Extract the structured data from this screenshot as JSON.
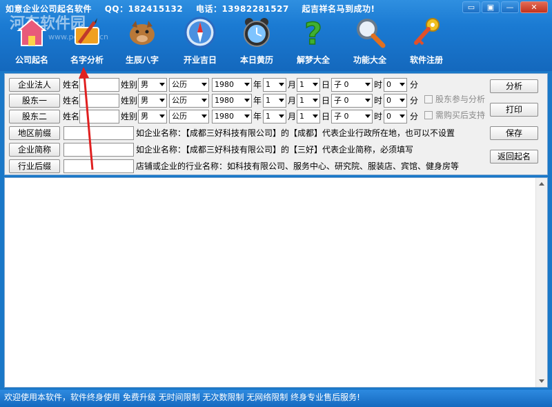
{
  "titlebar": {
    "app_title": "如意企业公司起名软件",
    "qq": "QQ：182415132",
    "phone": "电话：13982281527",
    "slogan": "起吉祥名马到成功!"
  },
  "window_controls": [
    "▭",
    "▣",
    "—",
    "✕"
  ],
  "watermark": {
    "main": "河东软件园",
    "sub": "www.pc0359.cn"
  },
  "toolbar": [
    {
      "label": "公司起名",
      "icon": "house-icon",
      "color": "#e85a7a"
    },
    {
      "label": "名字分析",
      "icon": "pencil-ruler-icon",
      "color": "#f0a020"
    },
    {
      "label": "生辰八字",
      "icon": "boar-icon",
      "color": "#b87838"
    },
    {
      "label": "开业吉日",
      "icon": "compass-icon",
      "color": "#3a80d8"
    },
    {
      "label": "本日黄历",
      "icon": "alarm-clock-icon",
      "color": "#4a4a4a"
    },
    {
      "label": "解梦大全",
      "icon": "question-icon",
      "color": "#40b030"
    },
    {
      "label": "功能大全",
      "icon": "magnifier-icon",
      "color": "#5a6a7a"
    },
    {
      "label": "软件注册",
      "icon": "keys-icon",
      "color": "#e0502a"
    }
  ],
  "form": {
    "persons": [
      {
        "button": "企业法人",
        "name_label": "姓名",
        "name_value": "",
        "gender_label": "姓别",
        "gender": "男",
        "calendar": "公历",
        "year": "1980",
        "year_unit": "年",
        "month": "1",
        "month_unit": "月",
        "day": "1",
        "day_unit": "日",
        "hour": "子 0",
        "hour_unit": "时",
        "minute": "0",
        "minute_unit": "分"
      },
      {
        "button": "股东一",
        "name_label": "姓名",
        "name_value": "",
        "gender_label": "姓别",
        "gender": "男",
        "calendar": "公历",
        "year": "1980",
        "year_unit": "年",
        "month": "1",
        "month_unit": "月",
        "day": "1",
        "day_unit": "日",
        "hour": "子 0",
        "hour_unit": "时",
        "minute": "0",
        "minute_unit": "分"
      },
      {
        "button": "股东二",
        "name_label": "姓名",
        "name_value": "",
        "gender_label": "姓别",
        "gender": "男",
        "calendar": "公历",
        "year": "1980",
        "year_unit": "年",
        "month": "1",
        "month_unit": "月",
        "day": "1",
        "day_unit": "日",
        "hour": "子 0",
        "hour_unit": "时",
        "minute": "0",
        "minute_unit": "分"
      }
    ],
    "options": [
      {
        "label": "股东参与分析",
        "checked": false
      },
      {
        "label": "需购买后支持",
        "checked": false
      }
    ],
    "fields": [
      {
        "button": "地区前缀",
        "value": "",
        "hint": "如企业名称：【成都三好科技有限公司】的【成都】代表企业行政所在地，也可以不设置"
      },
      {
        "button": "企业简称",
        "value": "",
        "hint": "如企业名称：【成都三好科技有限公司】的【三好】代表企业简称，必须填写"
      },
      {
        "button": "行业后缀",
        "value": "",
        "hint": "店铺或企业的行业名称：如科技有限公司、服务中心、研究院、服装店、宾馆、健身房等"
      }
    ],
    "actions": [
      "分析",
      "打印",
      "保存",
      "返回起名"
    ]
  },
  "status_bar": "欢迎使用本软件，软件终身使用 免费升级 无时间限制 无次数限制 无网络限制 终身专业售后服务!",
  "accent": {
    "annotation_red": "#e02020"
  }
}
